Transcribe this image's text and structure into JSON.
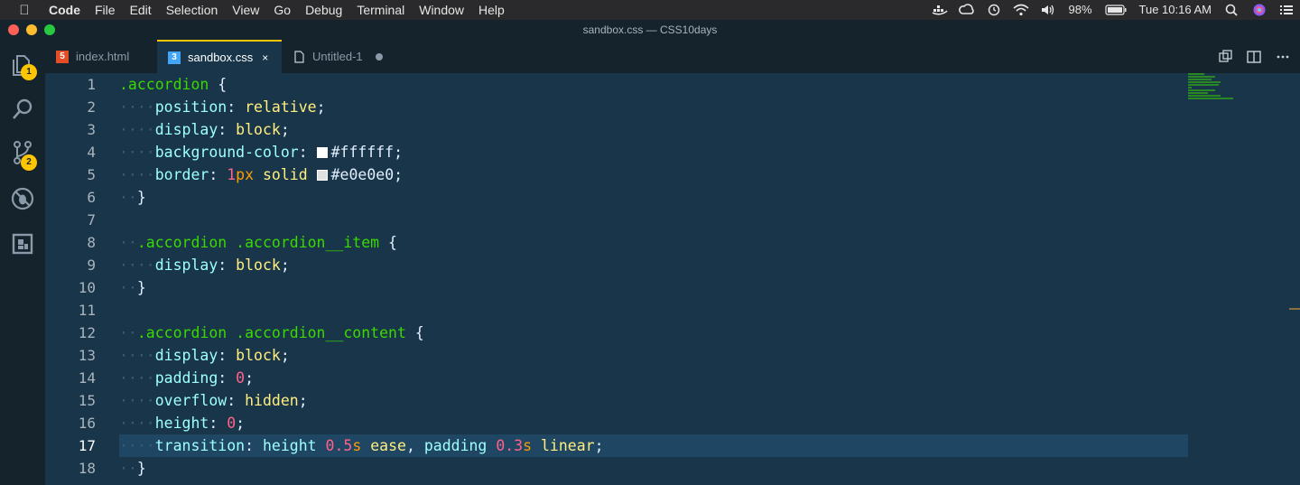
{
  "menubar": {
    "apple_icon": "apple-icon",
    "app_name": "Code",
    "menus": [
      "File",
      "Edit",
      "Selection",
      "View",
      "Go",
      "Debug",
      "Terminal",
      "Window",
      "Help"
    ],
    "battery": "98%",
    "clock": "Tue 10:16 AM"
  },
  "window": {
    "title": "sandbox.css — CSS10days"
  },
  "activity_bar": {
    "explorer_badge": "1",
    "scm_badge": "2"
  },
  "tabs": [
    {
      "label": "index.html",
      "icon": "html5-icon",
      "color": "#e44d26"
    },
    {
      "label": "sandbox.css",
      "icon": "css3-icon",
      "color": "#42a5f5",
      "close": "×"
    },
    {
      "label": "Untitled-1",
      "icon": "file-icon"
    }
  ],
  "editor": {
    "line_numbers": [
      "1",
      "2",
      "3",
      "4",
      "5",
      "6",
      "7",
      "8",
      "9",
      "10",
      "11",
      "12",
      "13",
      "14",
      "15",
      "16",
      "17",
      "18"
    ],
    "current_line": 17,
    "colors": {
      "background": "#193549",
      "selector": "#3ad900",
      "property": "#9effff",
      "value": "#ffee80",
      "number": "#ff628c",
      "unit": "#ff9d00",
      "accent": "#ffc600"
    },
    "code": {
      "l1_sel": ".accordion",
      "l1_brace": " {",
      "l2_prop": "position",
      "l2_val": "relative",
      "l3_prop": "display",
      "l3_val": "block",
      "l4_prop": "background-color",
      "l4_color": "#ffffff",
      "l5_prop": "border",
      "l5_num": "1",
      "l5_unit": "px",
      "l5_kw": "solid",
      "l5_color": "#e0e0e0",
      "l6_brace": "}",
      "l8_sel1": ".accordion",
      "l8_sel2": ".accordion__item",
      "l8_brace": "{",
      "l9_prop": "display",
      "l9_val": "block",
      "l10_brace": "}",
      "l12_sel1": ".accordion",
      "l12_sel2": ".accordion__content",
      "l12_brace": "{",
      "l13_prop": "display",
      "l13_val": "block",
      "l14_prop": "padding",
      "l14_num": "0",
      "l15_prop": "overflow",
      "l15_val": "hidden",
      "l16_prop": "height",
      "l16_num": "0",
      "l17_prop": "transition",
      "l17_v1": "height",
      "l17_n1": "0.5",
      "l17_u1": "s",
      "l17_k1": "ease",
      "l17_v2": "padding",
      "l17_n2": "0.3",
      "l17_u2": "s",
      "l17_k2": "linear",
      "l18_brace": "}"
    }
  }
}
